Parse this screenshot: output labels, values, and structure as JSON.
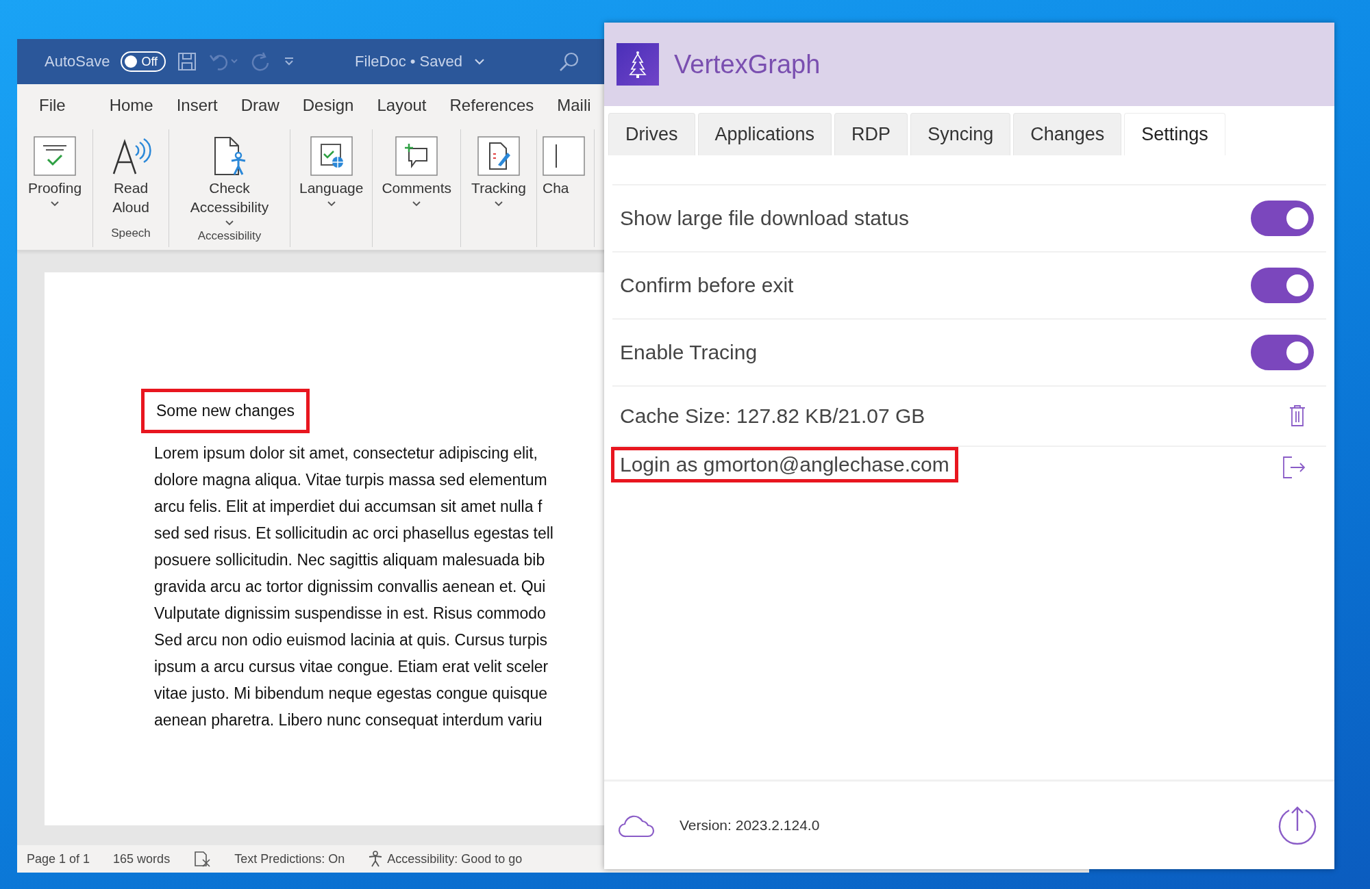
{
  "word": {
    "title_bar": {
      "autosave_label": "AutoSave",
      "autosave": {
        "on": false,
        "text": "Off"
      },
      "document_title": "FileDoc • Saved"
    },
    "menu_tabs": [
      "File",
      "Home",
      "Insert",
      "Draw",
      "Design",
      "Layout",
      "References",
      "Maili"
    ],
    "ribbon_groups": [
      {
        "commands": [
          {
            "kind": "proofing",
            "label": "Proofing",
            "dropdown": true
          }
        ]
      },
      {
        "label": "Speech",
        "commands": [
          {
            "kind": "read-aloud",
            "label": "Read Aloud",
            "dropdown": false
          }
        ]
      },
      {
        "label": "Accessibility",
        "commands": [
          {
            "kind": "accessibility",
            "label": "Check Accessibility",
            "dropdown": true
          }
        ]
      },
      {
        "commands": [
          {
            "kind": "language",
            "label": "Language",
            "dropdown": true
          }
        ]
      },
      {
        "commands": [
          {
            "kind": "comments",
            "label": "Comments",
            "dropdown": true
          }
        ]
      },
      {
        "commands": [
          {
            "kind": "tracking",
            "label": "Tracking",
            "dropdown": true
          }
        ]
      },
      {
        "commands": [
          {
            "kind": "changes",
            "label": "Cha",
            "dropdown": false
          }
        ]
      }
    ],
    "document": {
      "heading": {
        "text": "Some new changes",
        "highlighted": true
      },
      "lines": [
        "Lorem ipsum dolor sit amet, consectetur adipiscing elit,",
        "dolore magna aliqua. Vitae turpis massa sed elementum",
        "arcu felis. Elit at imperdiet dui accumsan sit amet nulla f",
        "sed sed risus. Et sollicitudin ac orci phasellus egestas tell",
        "posuere sollicitudin. Nec sagittis aliquam malesuada bib",
        "gravida arcu ac tortor dignissim convallis aenean et. Qui",
        "Vulputate dignissim suspendisse in est. Risus commodo",
        "Sed arcu non odio euismod lacinia at quis. Cursus turpis",
        "ipsum a arcu cursus vitae congue. Etiam erat velit sceler",
        "vitae justo. Mi bibendum neque egestas congue quisque",
        "aenean pharetra. Libero nunc consequat interdum variu"
      ]
    },
    "status_bar": {
      "page": "Page 1 of 1",
      "words": "165 words",
      "text_predictions": "Text Predictions: On",
      "accessibility": "Accessibility: Good to go"
    }
  },
  "app": {
    "title": "VertexGraph",
    "tabs": [
      {
        "label": "Drives",
        "selected": false
      },
      {
        "label": "Applications",
        "selected": false
      },
      {
        "label": "RDP",
        "selected": false
      },
      {
        "label": "Syncing",
        "selected": false
      },
      {
        "label": "Changes",
        "selected": false
      },
      {
        "label": "Settings",
        "selected": true
      }
    ],
    "settings": [
      {
        "kind": "toggle",
        "label": "Show large file download status",
        "on": true
      },
      {
        "kind": "toggle",
        "label": "Confirm before exit",
        "on": true
      },
      {
        "kind": "toggle",
        "label": "Enable Tracing",
        "on": true
      },
      {
        "kind": "clear",
        "label": "Cache Size: 127.82 KB/21.07 GB",
        "highlighted": false
      },
      {
        "kind": "logout",
        "label": "Login as gmorton@anglechase.com",
        "highlighted": true
      }
    ],
    "footer": {
      "version": "Version: 2023.2.124.0"
    }
  }
}
